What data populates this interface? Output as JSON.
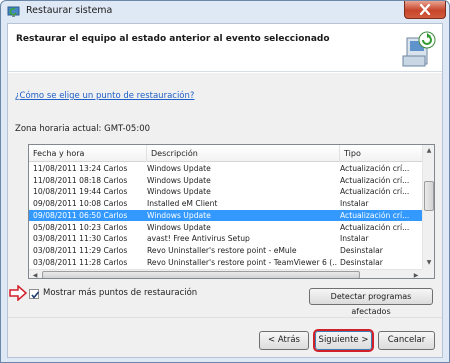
{
  "window": {
    "title": "Restaurar sistema"
  },
  "header": {
    "title": "Restaurar el equipo al estado anterior al evento seleccionado"
  },
  "help_link": "¿Cómo se elige un punto de restauración?",
  "timezone_label": "Zona horaria actual: GMT-05:00",
  "table": {
    "columns": [
      "Fecha y hora",
      "Descripción",
      "Tipo"
    ],
    "rows": [
      {
        "date": "11/08/2011 13:24  Carlos",
        "description": "Windows Update",
        "type": "Actualización crí..."
      },
      {
        "date": "11/08/2011 08:18  Carlos",
        "description": "Windows Update",
        "type": "Actualización crí..."
      },
      {
        "date": "10/08/2011 19:44  Carlos",
        "description": "Windows Update",
        "type": "Actualización crí..."
      },
      {
        "date": "09/08/2011 10:08  Carlos",
        "description": "Installed eM Client",
        "type": "Instalar"
      },
      {
        "date": "09/08/2011 06:50  Carlos",
        "description": "Windows Update",
        "type": "Actualización crí..."
      },
      {
        "date": "05/08/2011 10:23  Carlos",
        "description": "Windows Update",
        "type": "Actualización crí..."
      },
      {
        "date": "03/08/2011 11:30  Carlos",
        "description": "avast! Free Antivirus Setup",
        "type": "Instalar"
      },
      {
        "date": "03/08/2011 11:29  Carlos",
        "description": "Revo Uninstaller's restore point - eMule",
        "type": "Desinstalar"
      },
      {
        "date": "03/08/2011 11:28  Carlos",
        "description": "Revo Uninstaller's restore point - TeamViewer 6 (...",
        "type": "Desinstalar"
      }
    ],
    "selected_index": 4
  },
  "checkbox": {
    "label": "Mostrar más puntos de restauración",
    "checked": true
  },
  "buttons": {
    "detect": "Detectar programas afectados",
    "back": "< Atrás",
    "next": "Siguiente >",
    "cancel": "Cancelar"
  },
  "colors": {
    "selection": "#3399ff",
    "link": "#1f5fc8",
    "highlight": "#d21f2a"
  }
}
